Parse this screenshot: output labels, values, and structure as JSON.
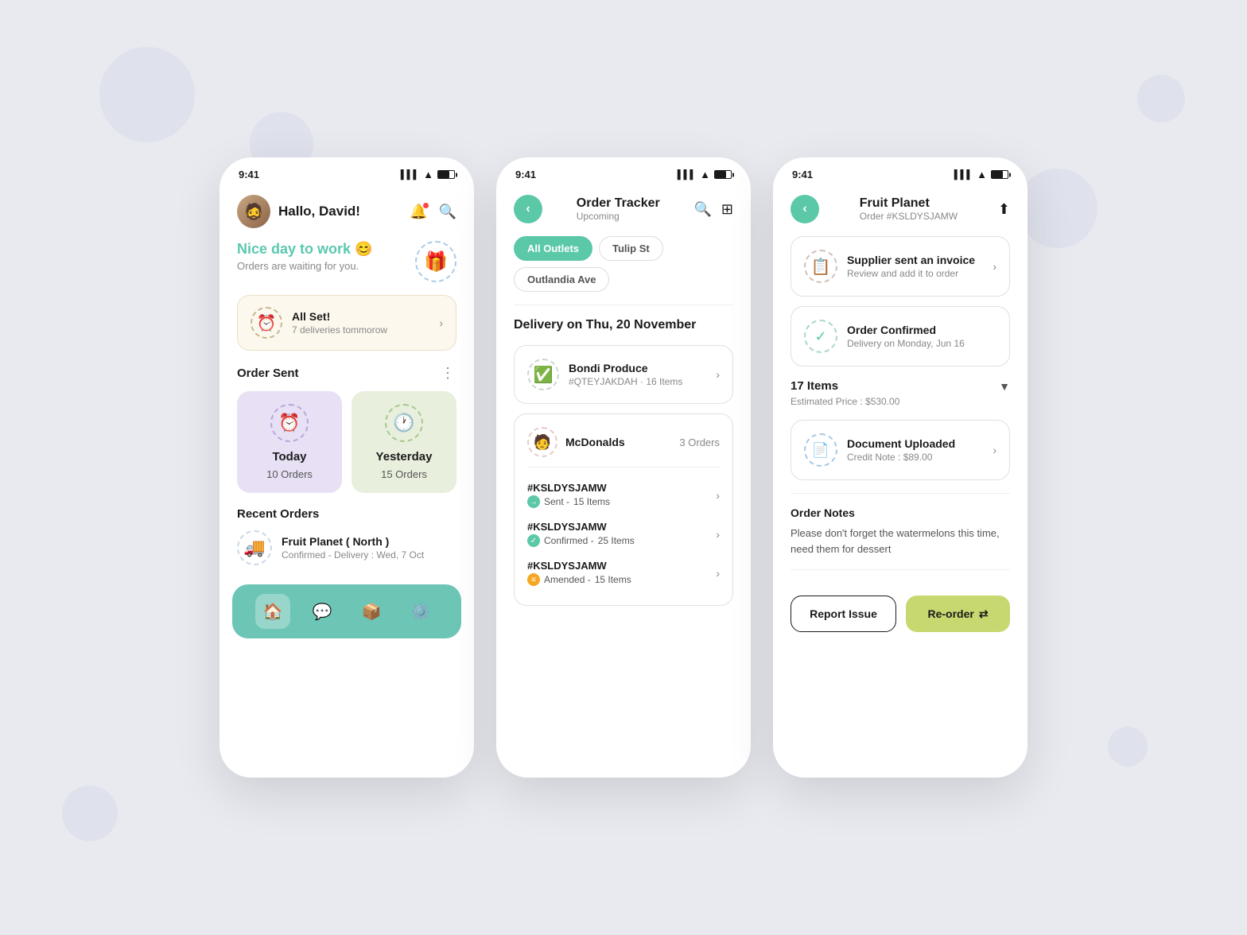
{
  "background": {
    "color": "#e8eaf2"
  },
  "phone1": {
    "status_time": "9:41",
    "header": {
      "greeting": "Hallo, David!",
      "avatar_emoji": "👤"
    },
    "hero": {
      "main_text": "Nice day to work 😊",
      "sub_text": "Orders are waiting for you.",
      "gift_emoji": "🎁"
    },
    "allset_card": {
      "title": "All Set!",
      "subtitle": "7 deliveries tommorow",
      "icon": "⏰"
    },
    "order_sent": {
      "section_title": "Order Sent",
      "today": {
        "label": "Today",
        "count": "10 Orders",
        "icon": "⏰"
      },
      "yesterday": {
        "label": "Yesterday",
        "count": "15 Orders",
        "icon": "🕐"
      }
    },
    "recent_orders": {
      "section_title": "Recent Orders",
      "items": [
        {
          "name": "Fruit Planet ( North )",
          "status": "Confirmed - Delivery : Wed, 7 Oct",
          "icon": "🚚"
        }
      ]
    },
    "nav": {
      "items": [
        "🏠",
        "💬",
        "📦",
        "⚙️"
      ]
    }
  },
  "phone2": {
    "status_time": "9:41",
    "header": {
      "title": "Order Tracker",
      "subtitle": "Upcoming"
    },
    "filters": [
      "All Outlets",
      "Tulip St",
      "Outlandia Ave"
    ],
    "active_filter": "All Outlets",
    "delivery_date": "Delivery on Thu, 20 November",
    "suppliers": [
      {
        "name": "Bondi Produce",
        "order_ref": "#QTEYJAKDAH · 16 Items",
        "icon": "✅"
      }
    ],
    "mcdonalds": {
      "name": "McDonalds",
      "orders_label": "3 Orders",
      "icon": "🧑",
      "orders": [
        {
          "id": "#KSLDYSJAMW",
          "status": "Sent",
          "items": "15 Items",
          "status_type": "sent"
        },
        {
          "id": "#KSLDYSJAMW",
          "status": "Confirmed",
          "items": "25 Items",
          "status_type": "confirmed"
        },
        {
          "id": "#KSLDYSJAMW",
          "status": "Amended",
          "items": "15 Items",
          "status_type": "amended"
        }
      ]
    }
  },
  "phone3": {
    "status_time": "9:41",
    "header": {
      "supplier_name": "Fruit Planet",
      "order_ref": "Order #KSLDYSJAMW"
    },
    "invoice_card": {
      "title": "Supplier sent an invoice",
      "subtitle": "Review and add it to order",
      "icon": "📋"
    },
    "confirmed_card": {
      "title": "Order Confirmed",
      "subtitle": "Delivery on Monday, Jun 16",
      "icon": "✅"
    },
    "items": {
      "count": "17 Items",
      "estimated_price": "Estimated Price : $530.00"
    },
    "document_card": {
      "title": "Document Uploaded",
      "subtitle": "Credit Note : $89.00",
      "icon": "📄"
    },
    "order_notes": {
      "title": "Order Notes",
      "text": "Please don't forget the watermelons this time, need them for dessert"
    },
    "actions": {
      "report_label": "Report Issue",
      "reorder_label": "Re-order"
    }
  }
}
